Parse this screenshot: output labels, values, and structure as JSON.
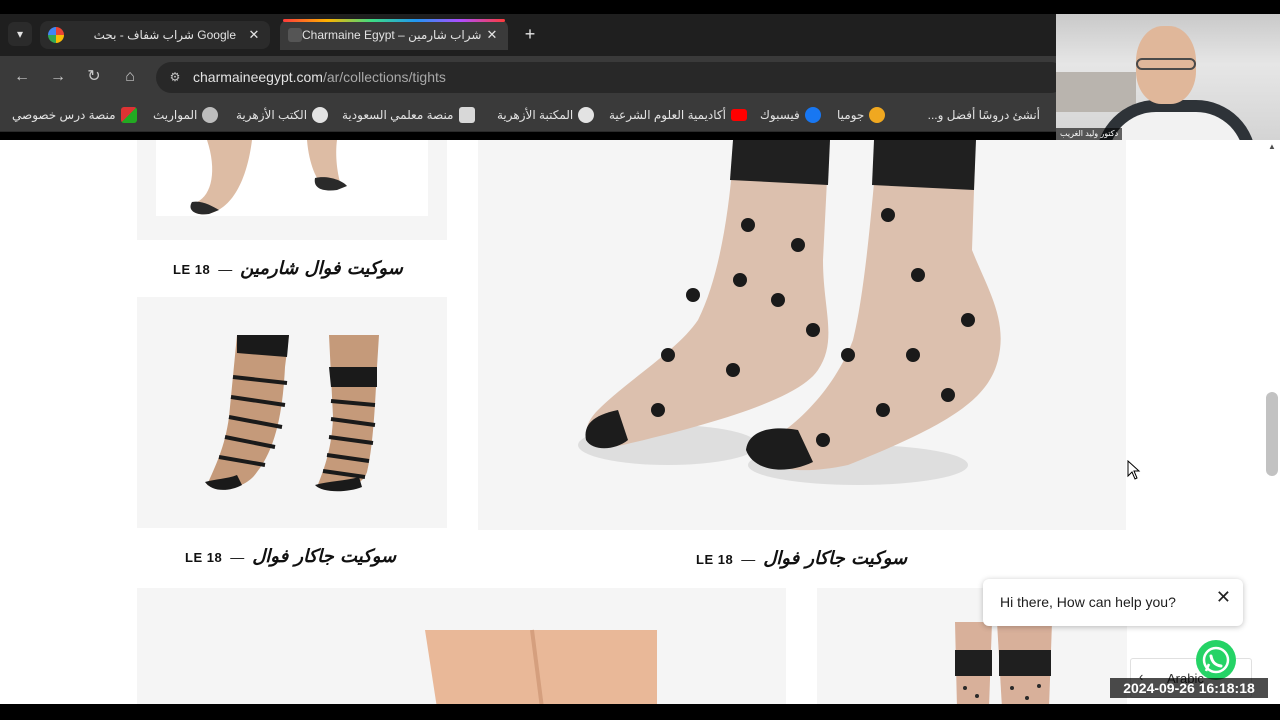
{
  "browser": {
    "tabs": [
      {
        "title": "شراب شفاف - بحث Google",
        "active": false
      },
      {
        "title": "Charmaine Egypt – شراب شارمين",
        "active": true
      }
    ],
    "url_host": "charmaineegypt.com",
    "url_path": "/ar/collections/tights",
    "bookmarks": [
      {
        "label": "أنشئ دروسًا أفضل و...",
        "icon": "bookmark-icon"
      },
      {
        "label": "جوميا",
        "icon": "star-icon"
      },
      {
        "label": "فيسبوك",
        "icon": "facebook-icon"
      },
      {
        "label": "أكاديمية العلوم الشرعية",
        "icon": "youtube-icon"
      },
      {
        "label": "المكتبة الأزهرية",
        "icon": "globe-icon"
      },
      {
        "label": "منصة معلمي السعودية",
        "icon": "site-icon"
      },
      {
        "label": "الكتب الأزهرية",
        "icon": "globe-icon"
      },
      {
        "label": "المواريث",
        "icon": "emblem-icon"
      },
      {
        "label": "منصة درس خصوصي",
        "icon": "flag-icon"
      }
    ]
  },
  "webcam": {
    "label": "دكتور وليد الغريب"
  },
  "products": [
    {
      "name": "سوكيت فوال شارمين",
      "price": "LE 18"
    },
    {
      "name": "سوكيت جاكار فوال",
      "price": "LE 18"
    },
    {
      "name": "سوكيت جاكار فوال",
      "price": "LE 18"
    }
  ],
  "chat": {
    "message": "Hi there, How can help you?"
  },
  "language": {
    "label": "Arabic"
  },
  "timestamp": "2024-09-26 16:18:18",
  "colors": {
    "whatsapp": "#25d366",
    "page_bg": "#ffffff",
    "card_bg": "#f5f5f5"
  }
}
